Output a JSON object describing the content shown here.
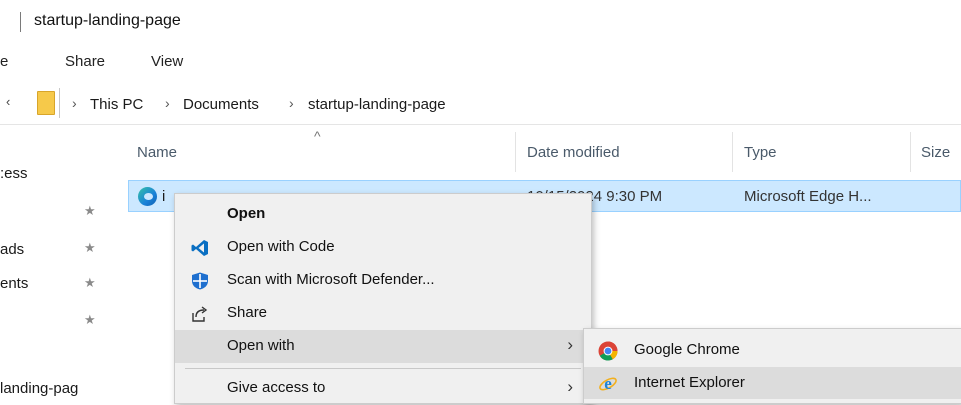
{
  "window": {
    "title": "startup-landing-page"
  },
  "ribbon": {
    "tabs": [
      "e",
      "Share",
      "View"
    ]
  },
  "address": {
    "back_glyph": "‹",
    "crumbs": [
      "This PC",
      "Documents",
      "startup-landing-page"
    ],
    "separator": "›"
  },
  "columns": {
    "sort_glyph": "^",
    "name": "Name",
    "date": "Date modified",
    "type": "Type",
    "size": "Size"
  },
  "nav": {
    "items": [
      ":ess",
      "",
      "ads",
      "ents",
      "",
      "landing-pag"
    ],
    "pin_glyph": "★"
  },
  "file": {
    "name": "i",
    "date_partial": "10/15/2024 9:30 PM",
    "type": "Microsoft Edge H..."
  },
  "context_menu": {
    "open": "Open",
    "open_with_code": "Open with Code",
    "scan": "Scan with Microsoft Defender...",
    "share": "Share",
    "open_with": "Open with",
    "give_access": "Give access to",
    "arrow": "›"
  },
  "submenu": {
    "chrome": "Google Chrome",
    "ie": "Internet Explorer"
  },
  "colors": {
    "selection": "#cce8ff",
    "menu_bg": "#f0f0f0",
    "hover": "#dcdcdc",
    "vscode_blue": "#0a6fc2",
    "defender_blue": "#1e6fcf"
  }
}
